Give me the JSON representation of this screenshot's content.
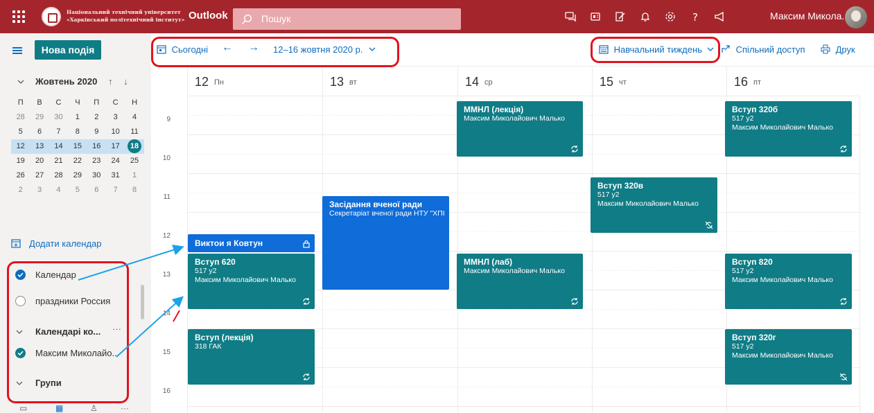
{
  "header": {
    "org_line1": "Національний технічний університет",
    "org_line2": "«Харківський політехнічний інститут»",
    "app_name": "Outlook",
    "search_placeholder": "Пошук",
    "user_name": "Максим Микола..",
    "icons": [
      "waffle-icon",
      "chat-icon",
      "meet-now-icon",
      "todo-icon",
      "bell-icon",
      "gear-icon",
      "help-icon",
      "feedback-icon"
    ]
  },
  "sidebar": {
    "new_event": "Нова подія",
    "month_title": "Жовтень 2020",
    "weekdays": [
      "П",
      "В",
      "С",
      "Ч",
      "П",
      "С",
      "Н"
    ],
    "weeks": [
      [
        "28",
        "29",
        "30",
        "1",
        "2",
        "3",
        "4"
      ],
      [
        "5",
        "6",
        "7",
        "8",
        "9",
        "10",
        "11"
      ],
      [
        "12",
        "13",
        "14",
        "15",
        "16",
        "17",
        "18"
      ],
      [
        "19",
        "20",
        "21",
        "22",
        "23",
        "24",
        "25"
      ],
      [
        "26",
        "27",
        "28",
        "29",
        "30",
        "31",
        "1"
      ],
      [
        "2",
        "3",
        "4",
        "5",
        "6",
        "7",
        "8"
      ]
    ],
    "add_calendar": "Додати календар",
    "calendars": [
      {
        "label": "Календар",
        "checked": true
      },
      {
        "label": "праздники Россия",
        "checked": false
      }
    ],
    "group_label": "Календарі ко...",
    "group_items": [
      {
        "label": "Максим Миколайо..",
        "checked": true
      }
    ],
    "groups_label": "Групи",
    "more": "···"
  },
  "toolbar": {
    "today": "Сьогодні",
    "range": "12–16 жовтня 2020 р.",
    "view": "Навчальний тиждень",
    "share": "Спільний доступ",
    "print": "Друк"
  },
  "days": [
    {
      "num": "12",
      "wd": "Пн"
    },
    {
      "num": "13",
      "wd": "вт"
    },
    {
      "num": "14",
      "wd": "ср"
    },
    {
      "num": "15",
      "wd": "чт"
    },
    {
      "num": "16",
      "wd": "пт"
    }
  ],
  "hours": [
    "9",
    "10",
    "11",
    "12",
    "13",
    "14",
    "15",
    "16"
  ],
  "events": [
    {
      "title": "ММНЛ (лекція)",
      "lines": [
        "Максим Миколайович Малько"
      ],
      "color": "#0f7c86",
      "icon": "recurring-icon"
    },
    {
      "title": "Вступ 320б",
      "lines": [
        "517 у2",
        "Максим Миколайович Малько"
      ],
      "color": "#0f7c86",
      "icon": "recurring-icon"
    },
    {
      "title": "Вступ 320в",
      "lines": [
        "517 у2",
        "Максим Миколайович Малько"
      ],
      "color": "#0f7c86",
      "icon": "recurring-off-icon"
    },
    {
      "title": "Засідання вченої ради",
      "lines": [
        "Секретаріат вченої ради НТУ \"ХПІ"
      ],
      "color": "#0f6cd8",
      "icon": ""
    },
    {
      "title": "Виктои я Ковтун",
      "lines": [],
      "color": "#0f6cd8",
      "icon": "lock-icon"
    },
    {
      "title": "Вступ 620",
      "lines": [
        "517 у2",
        "Максим Миколайович Малько"
      ],
      "color": "#0f7c86",
      "icon": "recurring-icon"
    },
    {
      "title": "ММНЛ (лаб)",
      "lines": [
        "Максим Миколайович Малько"
      ],
      "color": "#0f7c86",
      "icon": "recurring-icon"
    },
    {
      "title": "Вступ 820",
      "lines": [
        "517 у2",
        "Максим Миколайович Малько"
      ],
      "color": "#0f7c86",
      "icon": "recurring-icon"
    },
    {
      "title": "Вступ (лекція)",
      "lines": [
        "318 ГАК"
      ],
      "color": "#0f7c86",
      "icon": "recurring-icon"
    },
    {
      "title": "Вступ 320г",
      "lines": [
        "517 у2",
        "Максим Миколайович Малько"
      ],
      "color": "#0f7c86",
      "icon": "recurring-off-icon"
    }
  ],
  "colors": {
    "header": "#a4262c",
    "accent": "#0f7c86",
    "link": "#0f6cbd",
    "annotation": "#e2121c",
    "arrow": "#1aa3e8"
  }
}
